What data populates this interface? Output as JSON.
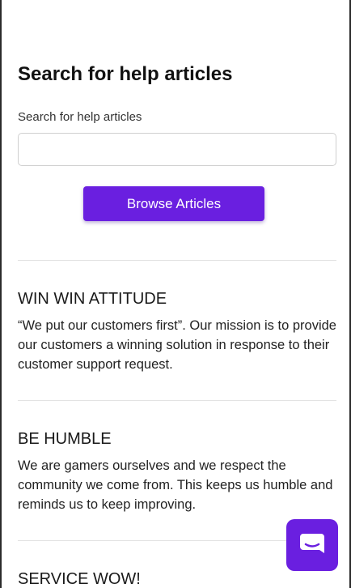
{
  "search": {
    "heading": "Search for help articles",
    "label": "Search for help articles",
    "value": "",
    "placeholder": ""
  },
  "browse_button": {
    "label": "Browse Articles"
  },
  "sections": [
    {
      "title": "WIN WIN ATTITUDE",
      "body": "“We put our customers first”. Our mission is to provide our customers a winning solution in response to their customer support request."
    },
    {
      "title": "BE HUMBLE",
      "body": "We are gamers ourselves and we respect the community we come from. This keeps us humble and reminds us to keep improving."
    },
    {
      "title": "SERVICE WOW!",
      "body": ""
    }
  ],
  "chat_widget": {
    "icon": "chat-bubble-icon"
  },
  "colors": {
    "accent": "#6a1fe0",
    "divider": "#e3e3e3",
    "text": "#1e1e1e"
  }
}
